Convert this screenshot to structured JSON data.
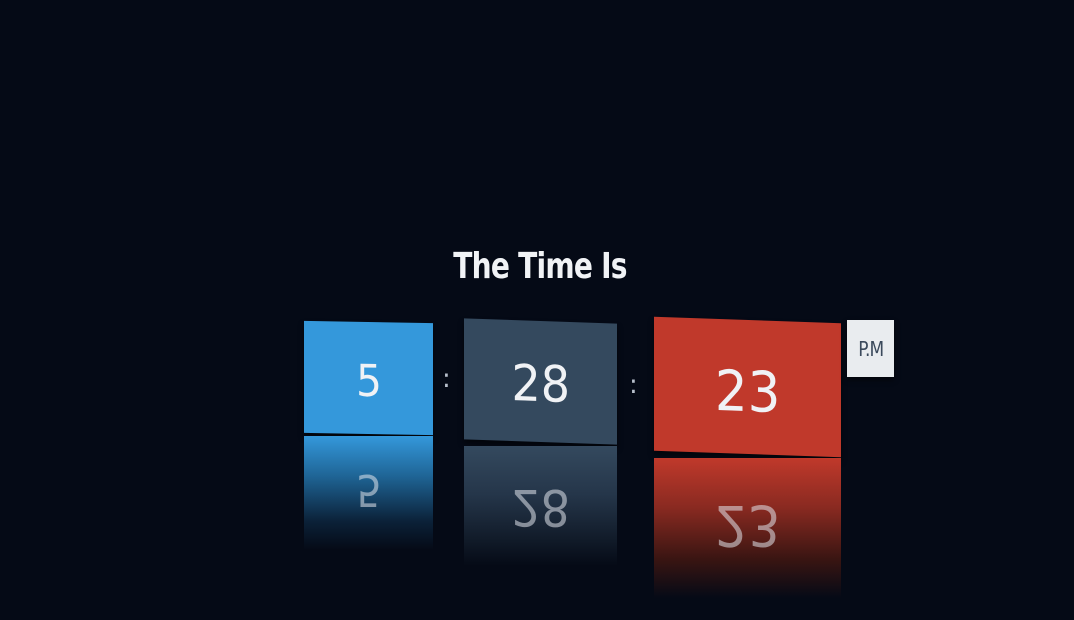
{
  "clock": {
    "title": "The Time Is",
    "hours": "5",
    "minutes": "28",
    "seconds": "23",
    "separator": ":",
    "meridiem": "P.M",
    "colors": {
      "background": "#050a16",
      "hours_tile": "#3498db",
      "minutes_tile": "#34495e",
      "seconds_tile": "#c0392b",
      "meridiem_badge": "#e9ecef"
    }
  }
}
